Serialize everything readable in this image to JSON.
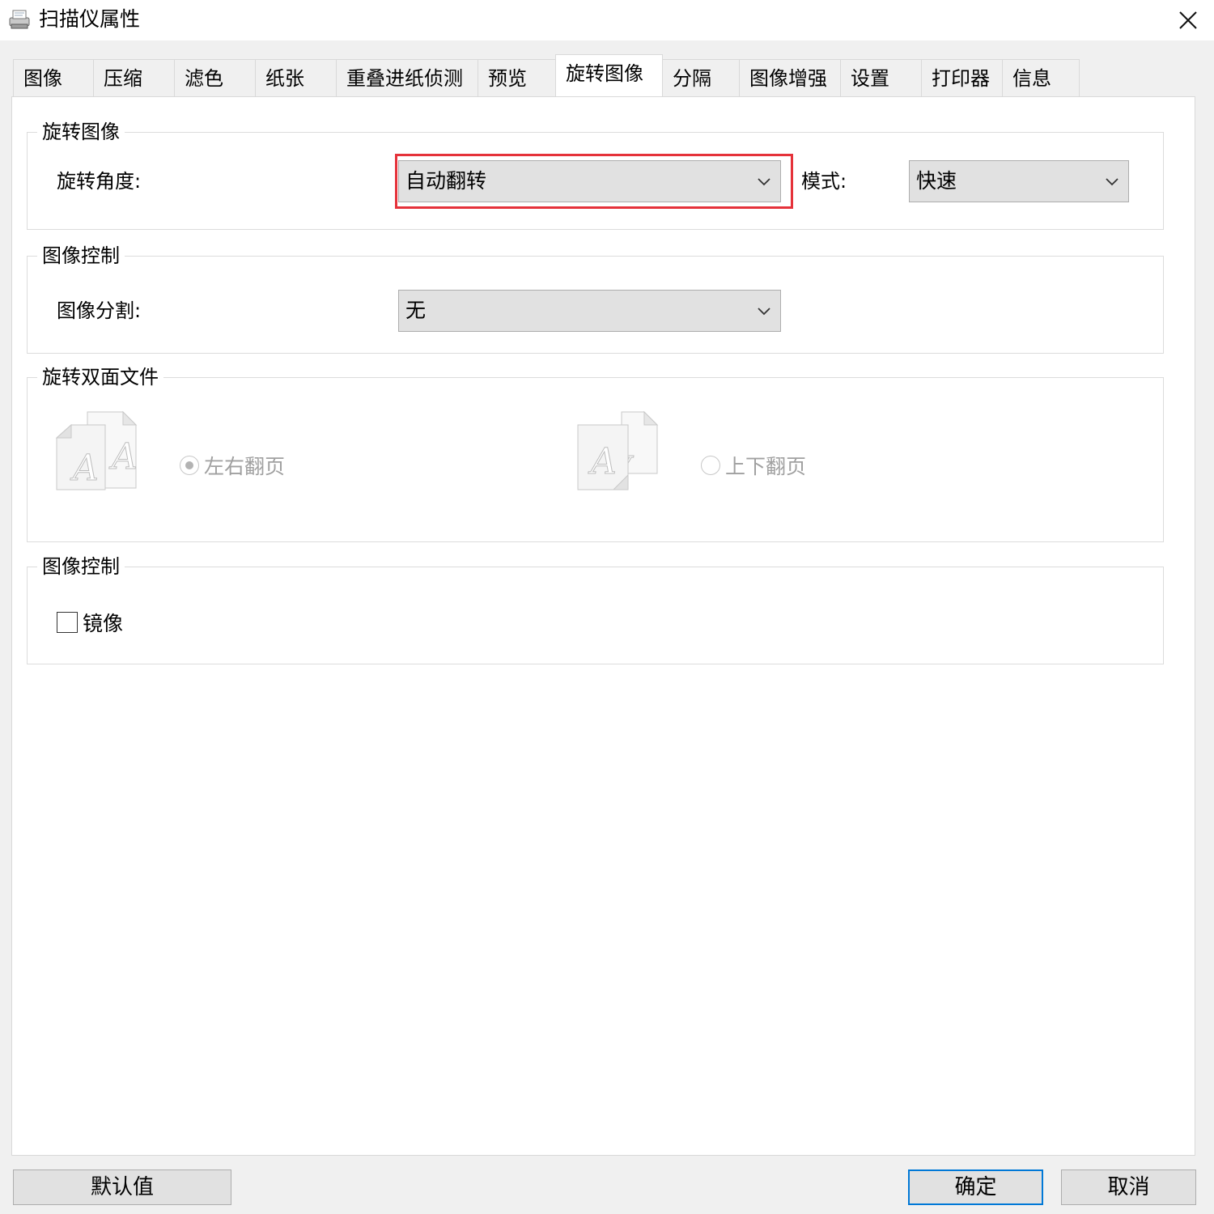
{
  "window": {
    "title": "扫描仪属性",
    "close_symbol": "✕"
  },
  "tabs": [
    {
      "label": "图像"
    },
    {
      "label": "压缩"
    },
    {
      "label": "滤色"
    },
    {
      "label": "纸张"
    },
    {
      "label": "重叠进纸侦测"
    },
    {
      "label": "预览"
    },
    {
      "label": "旋转图像",
      "active": true
    },
    {
      "label": "分隔"
    },
    {
      "label": "图像增强"
    },
    {
      "label": "设置"
    },
    {
      "label": "打印器"
    },
    {
      "label": "信息"
    }
  ],
  "rotate_group": {
    "title": "旋转图像",
    "angle_label": "旋转角度:",
    "angle_value": "自动翻转",
    "mode_label": "模式:",
    "mode_value": "快速"
  },
  "image_control_group": {
    "title": "图像控制",
    "split_label": "图像分割:",
    "split_value": "无"
  },
  "duplex_group": {
    "title": "旋转双面文件",
    "option_left_right": {
      "label": "左右翻页",
      "selected": true,
      "enabled": false
    },
    "option_top_bottom": {
      "label": "上下翻页",
      "selected": false,
      "enabled": false
    }
  },
  "mirror_group": {
    "title": "图像控制",
    "mirror_label": "镜像",
    "mirror_checked": false
  },
  "footer": {
    "default_button": "默认值",
    "ok_button": "确定",
    "cancel_button": "取消"
  },
  "colors": {
    "highlight": "#e5323a",
    "focus_border": "#0078d7"
  }
}
